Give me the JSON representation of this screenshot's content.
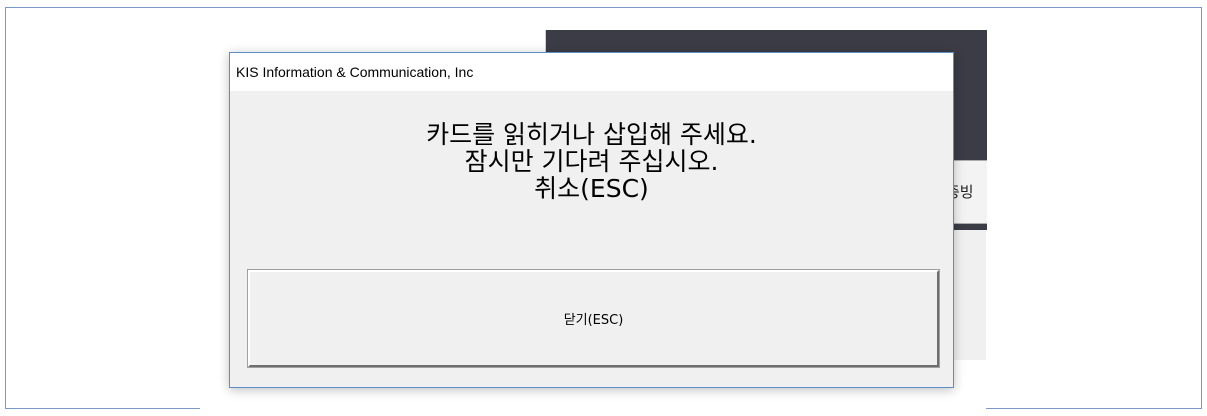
{
  "background_window": {
    "button_label": "증빙"
  },
  "dialog": {
    "title": "KIS Information & Communication, Inc",
    "message_lines": [
      "카드를 읽히거나 삽입해 주세요.",
      "잠시만 기다려 주십시오.",
      "취소(ESC)"
    ],
    "close_button_label": "닫기(ESC)"
  }
}
